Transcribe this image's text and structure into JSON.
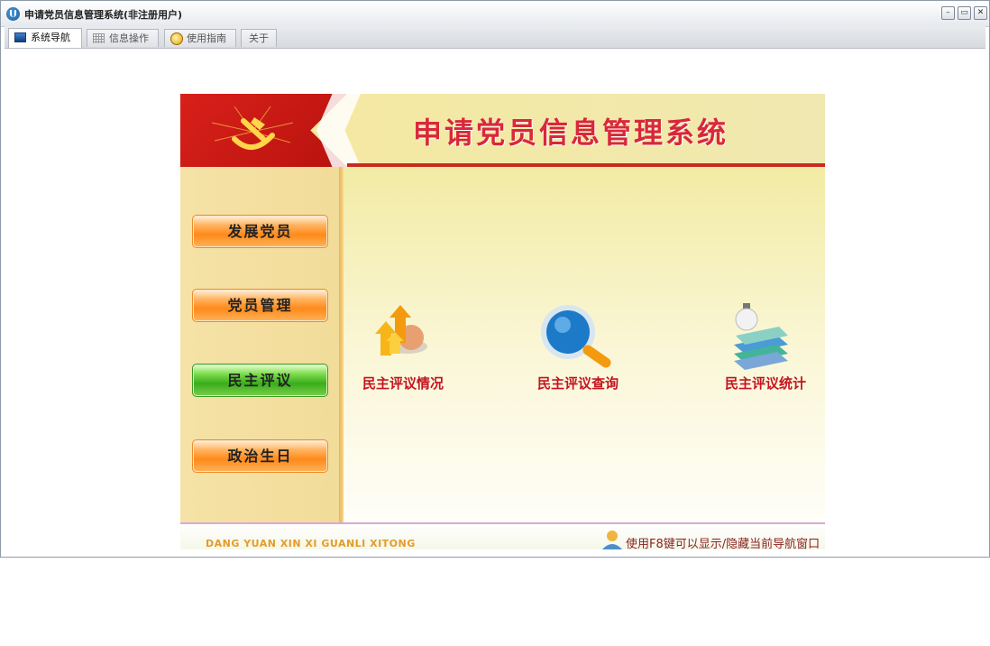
{
  "window": {
    "title": "申请党员信息管理系统(非注册用户)"
  },
  "tabs": [
    {
      "label": "系统导航",
      "icon": "monitor-icon",
      "active": true
    },
    {
      "label": "信息操作",
      "icon": "grid-icon",
      "active": false
    },
    {
      "label": "使用指南",
      "icon": "bulb-icon",
      "active": false
    },
    {
      "label": "关于",
      "icon": "",
      "active": false
    }
  ],
  "banner": {
    "title": "申请党员信息管理系统",
    "emblem": "party-emblem-icon"
  },
  "sidebar": {
    "buttons": [
      {
        "label": "发展党员",
        "style": "orange"
      },
      {
        "label": "党员管理",
        "style": "orange"
      },
      {
        "label": "民主评议",
        "style": "green"
      },
      {
        "label": "政治生日",
        "style": "orange"
      }
    ]
  },
  "features": [
    {
      "label": "民主评议情况",
      "icon": "arrows-globe-icon"
    },
    {
      "label": "民主评议查询",
      "icon": "magnifier-icon"
    },
    {
      "label": "民主评议统计",
      "icon": "books-bulb-icon"
    }
  ],
  "footer": {
    "left": "DANG YUAN XIN XI GUANLI XITONG",
    "right": "使用F8键可以显示/隐藏当前导航窗口"
  },
  "colors": {
    "accent_red": "#d8283a",
    "banner_red": "#c92a1e",
    "nav_orange": "#ff8a1a",
    "nav_green": "#3aad1b"
  }
}
